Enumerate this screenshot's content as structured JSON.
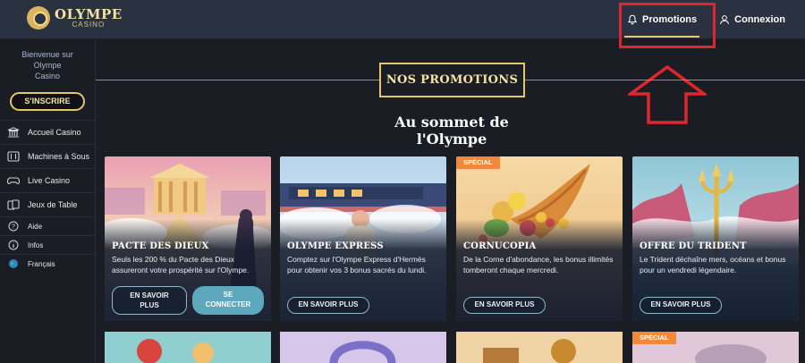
{
  "brand": {
    "name": "OLYMPE",
    "sub": "CASINO"
  },
  "nav": {
    "promotions": "Promotions",
    "login": "Connexion"
  },
  "sidebar": {
    "welcome": [
      "Bienvenue sur",
      "Olympe",
      "Casino"
    ],
    "signup": "S'INSCRIRE",
    "items": [
      {
        "label": "Accueil Casino",
        "icon": "temple-icon"
      },
      {
        "label": "Machines à Sous",
        "icon": "slot-machine-icon"
      },
      {
        "label": "Live Casino",
        "icon": "gamepad-icon"
      },
      {
        "label": "Jeux de Table",
        "icon": "cards-icon"
      }
    ],
    "small_items": [
      {
        "label": "Aide",
        "icon": "help-icon"
      },
      {
        "label": "Infos",
        "icon": "info-icon"
      },
      {
        "label": "Français",
        "icon": "globe-icon"
      }
    ]
  },
  "main": {
    "heading": "NOS PROMOTIONS",
    "subheading": "Au sommet de l'Olympe",
    "cards": [
      {
        "title": "PACTE DES DIEUX",
        "desc": "Seuls les 200 % du Pacte des Dieux assureront votre prospérité sur l'Olympe.",
        "btn1": [
          "EN SAVOIR",
          "PLUS"
        ],
        "btn2": [
          "SE",
          "CONNECTER"
        ]
      },
      {
        "title": "OLYMPE EXPRESS",
        "desc": "Comptez sur l'Olympe Express d'Hermès pour obtenir vos 3 bonus sacrés du lundi.",
        "btn": "EN SAVOIR PLUS"
      },
      {
        "title": "CORNUCOPIA",
        "badge": "SPÉCIAL",
        "desc": "De la Corne d'abondance, les bonus illimités tomberont chaque mercredi.",
        "btn": "EN SAVOIR PLUS"
      },
      {
        "title": "OFFRE DU TRIDENT",
        "desc": "Le Trident déchaîne mers, océans et bonus pour un vendredi légendaire.",
        "btn": "EN SAVOIR PLUS"
      }
    ],
    "row2_badge": "SPÉCIAL"
  },
  "colors": {
    "gold": "#e2c56d",
    "topbar": "#2a3140",
    "bg": "#1b1d24",
    "highlight": "#e0262d",
    "teal": "#5ea8bd",
    "badge": "#f08a3a"
  }
}
